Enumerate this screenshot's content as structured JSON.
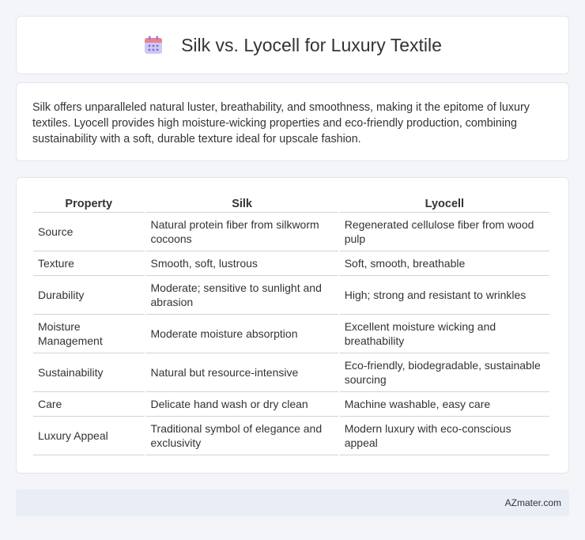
{
  "header": {
    "title": "Silk vs. Lyocell for Luxury Textile",
    "icon": "calendar-icon",
    "icon_colors": {
      "body": "#c9c3f0",
      "top": "#ec7d8c",
      "dots": "#7a6fd6"
    }
  },
  "summary": {
    "text": "Silk offers unparalleled natural luster, breathability, and smoothness, making it the epitome of luxury textiles. Lyocell provides high moisture-wicking properties and eco-friendly production, combining sustainability with a soft, durable texture ideal for upscale fashion."
  },
  "table": {
    "headers": [
      "Property",
      "Silk",
      "Lyocell"
    ],
    "rows": [
      [
        "Source",
        "Natural protein fiber from silkworm cocoons",
        "Regenerated cellulose fiber from wood pulp"
      ],
      [
        "Texture",
        "Smooth, soft, lustrous",
        "Soft, smooth, breathable"
      ],
      [
        "Durability",
        "Moderate; sensitive to sunlight and abrasion",
        "High; strong and resistant to wrinkles"
      ],
      [
        "Moisture Management",
        "Moderate moisture absorption",
        "Excellent moisture wicking and breathability"
      ],
      [
        "Sustainability",
        "Natural but resource-intensive",
        "Eco-friendly, biodegradable, sustainable sourcing"
      ],
      [
        "Care",
        "Delicate hand wash or dry clean",
        "Machine washable, easy care"
      ],
      [
        "Luxury Appeal",
        "Traditional symbol of elegance and exclusivity",
        "Modern luxury with eco-conscious appeal"
      ]
    ]
  },
  "footer": {
    "text": "AZmater.com"
  }
}
